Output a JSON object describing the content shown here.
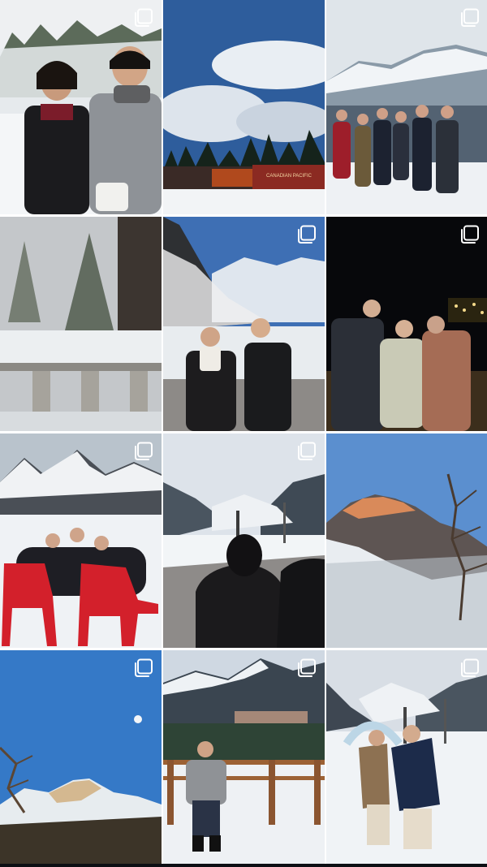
{
  "screen": {
    "name": "profile-photo-grid",
    "background": "#ffffff"
  },
  "posts": [
    {
      "id": "post-1",
      "scene": "two-friends-snowy-river",
      "multi_photo": true
    },
    {
      "id": "post-2",
      "scene": "canadian-pacific-train-forest",
      "multi_photo": false,
      "sign_text": "CANADIAN PACIFIC"
    },
    {
      "id": "post-3",
      "scene": "family-group-mountain-view",
      "multi_photo": true
    },
    {
      "id": "post-4",
      "scene": "snow-covered-railing-trees",
      "multi_photo": false
    },
    {
      "id": "post-5",
      "scene": "couple-at-lake-louise",
      "multi_photo": true
    },
    {
      "id": "post-6",
      "scene": "family-at-night",
      "multi_photo": true
    },
    {
      "id": "post-7",
      "scene": "red-adirondack-chairs-mountains",
      "multi_photo": true
    },
    {
      "id": "post-8",
      "scene": "back-view-frozen-lake",
      "multi_photo": true
    },
    {
      "id": "post-9",
      "scene": "sunlit-mountain-peak",
      "multi_photo": false
    },
    {
      "id": "post-10",
      "scene": "moon-over-snowy-peaks",
      "multi_photo": true
    },
    {
      "id": "post-11",
      "scene": "man-at-railing-castle-hotel",
      "multi_photo": true
    },
    {
      "id": "post-12",
      "scene": "couple-ice-arch-lake",
      "multi_photo": true
    }
  ],
  "colors": {
    "multi_icon": "#ffffff",
    "gap": "#ffffff"
  }
}
